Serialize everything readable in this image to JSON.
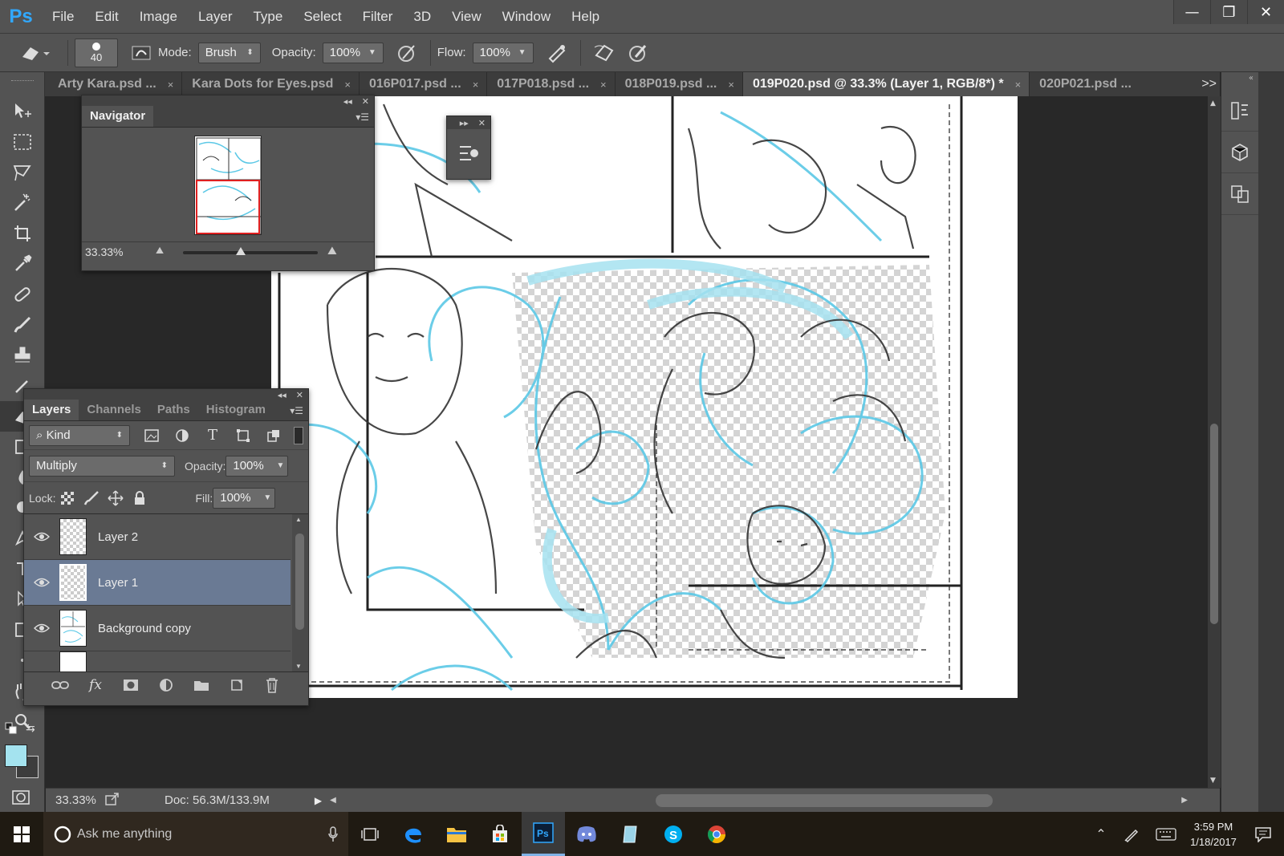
{
  "app": {
    "logo": "Ps"
  },
  "menu": [
    "File",
    "Edit",
    "Image",
    "Layer",
    "Type",
    "Select",
    "Filter",
    "3D",
    "View",
    "Window",
    "Help"
  ],
  "window_controls": {
    "minimize": "—",
    "restore": "❐",
    "close": "✕"
  },
  "options": {
    "brush_size": "40",
    "mode_label": "Mode:",
    "mode_value": "Brush",
    "opacity_label": "Opacity:",
    "opacity_value": "100%",
    "flow_label": "Flow:",
    "flow_value": "100%"
  },
  "tabs": [
    {
      "label": "Arty Kara.psd ...",
      "active": false
    },
    {
      "label": "Kara Dots for Eyes.psd",
      "active": false
    },
    {
      "label": "016P017.psd ...",
      "active": false
    },
    {
      "label": "017P018.psd ...",
      "active": false
    },
    {
      "label": "018P019.psd ...",
      "active": false
    },
    {
      "label": "019P020.psd @ 33.3% (Layer 1, RGB/8*) *",
      "active": true
    },
    {
      "label": "020P021.psd ...",
      "active": false
    }
  ],
  "tab_close": "×",
  "tab_more": ">>",
  "navigator": {
    "title": "Navigator",
    "zoom": "33.33%"
  },
  "layers_panel": {
    "tabs": [
      "Layers",
      "Channels",
      "Paths",
      "Histogram"
    ],
    "filter_label": "Kind",
    "blend_mode": "Multiply",
    "opacity_label": "Opacity:",
    "opacity_value": "100%",
    "lock_label": "Lock:",
    "fill_label": "Fill:",
    "fill_value": "100%",
    "layers": [
      {
        "name": "Layer 2",
        "selected": false
      },
      {
        "name": "Layer 1",
        "selected": true
      },
      {
        "name": "Background copy",
        "selected": false
      }
    ]
  },
  "status": {
    "zoom": "33.33%",
    "doc": "Doc: 56.3M/133.9M"
  },
  "taskbar": {
    "search_placeholder": "Ask me anything",
    "time": "3:59 PM",
    "date": "1/18/2017"
  },
  "colors": {
    "foreground": "#a4e3ef",
    "background": "#3d3d3d",
    "selection": "#6a7a94",
    "accent": "#31a8ff",
    "sketch_blue": "#5bc8e6"
  }
}
